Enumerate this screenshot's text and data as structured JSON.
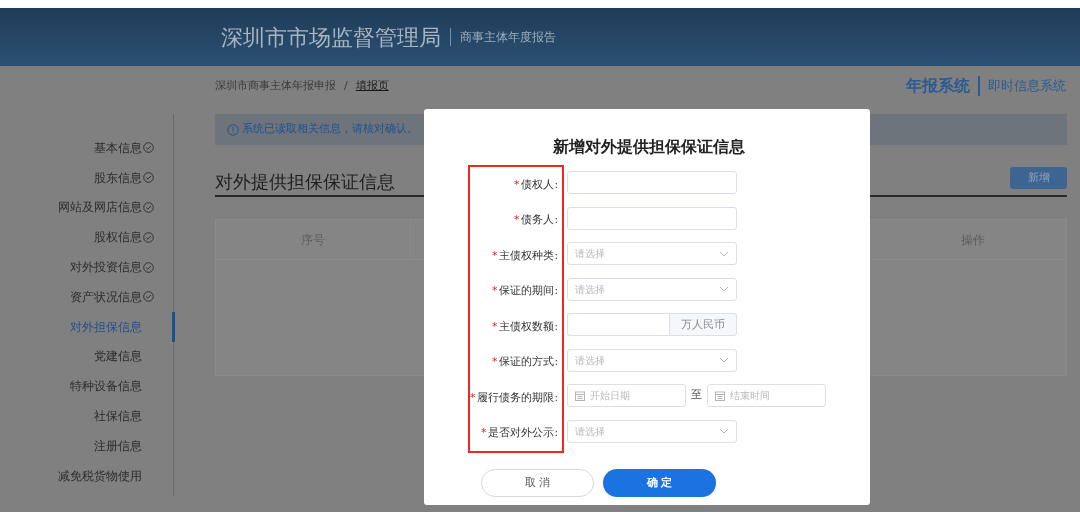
{
  "header": {
    "title": "深圳市市场监督管理局",
    "subtitle": "商事主体年度报告"
  },
  "breadcrumb_separator": "/",
  "breadcrumb": [
    {
      "label": "深圳市商事主体年报申报",
      "current": false
    },
    {
      "label": "填报页",
      "current": true
    }
  ],
  "system_links": [
    {
      "label": "年报系统",
      "selected": true
    },
    {
      "label": "即时信息系统",
      "selected": false
    }
  ],
  "sidebar": {
    "items": [
      {
        "label": "基本信息",
        "done": true,
        "selected": false
      },
      {
        "label": "股东信息",
        "done": true,
        "selected": false
      },
      {
        "label": "网站及网店信息",
        "done": true,
        "selected": false
      },
      {
        "label": "股权信息",
        "done": true,
        "selected": false
      },
      {
        "label": "对外投资信息",
        "done": true,
        "selected": false
      },
      {
        "label": "资产状况信息",
        "done": true,
        "selected": false
      },
      {
        "label": "对外担保信息",
        "done": false,
        "selected": true
      },
      {
        "label": "党建信息",
        "done": false,
        "selected": false
      },
      {
        "label": "特种设备信息",
        "done": false,
        "selected": false
      },
      {
        "label": "社保信息",
        "done": false,
        "selected": false
      },
      {
        "label": "注册信息",
        "done": false,
        "selected": false
      },
      {
        "label": "减免税货物使用",
        "done": false,
        "selected": false
      }
    ]
  },
  "alert": "系统已读取相关信息，请核对确认。",
  "section": {
    "title": "对外提供担保保证信息",
    "add_button": "新增"
  },
  "table": {
    "columns": [
      "序号",
      "操作"
    ]
  },
  "dialog": {
    "title": "新增对外提供担保保证信息",
    "labels_highlighted": true,
    "required_mark": "*",
    "fields": [
      {
        "kind": "text",
        "label": "债权人:",
        "required": true
      },
      {
        "kind": "text",
        "label": "债务人:",
        "required": true
      },
      {
        "kind": "select",
        "label": "主债权种类:",
        "required": true,
        "placeholder": "请选择"
      },
      {
        "kind": "select",
        "label": "保证的期间:",
        "required": true,
        "placeholder": "请选择"
      },
      {
        "kind": "unit",
        "label": "主债权数额:",
        "required": true,
        "unit": "万人民币"
      },
      {
        "kind": "select",
        "label": "保证的方式:",
        "required": true,
        "placeholder": "请选择"
      },
      {
        "kind": "daterange",
        "label": "履行债务的期限:",
        "required": true,
        "start_placeholder": "开始日期",
        "separator": "至",
        "end_placeholder": "结束时间"
      },
      {
        "kind": "select",
        "label": "是否对外公示:",
        "required": true,
        "placeholder": "请选择"
      }
    ],
    "buttons": [
      {
        "kind": "cancel",
        "label": "取 消"
      },
      {
        "kind": "primary",
        "label": "确 定"
      }
    ]
  }
}
